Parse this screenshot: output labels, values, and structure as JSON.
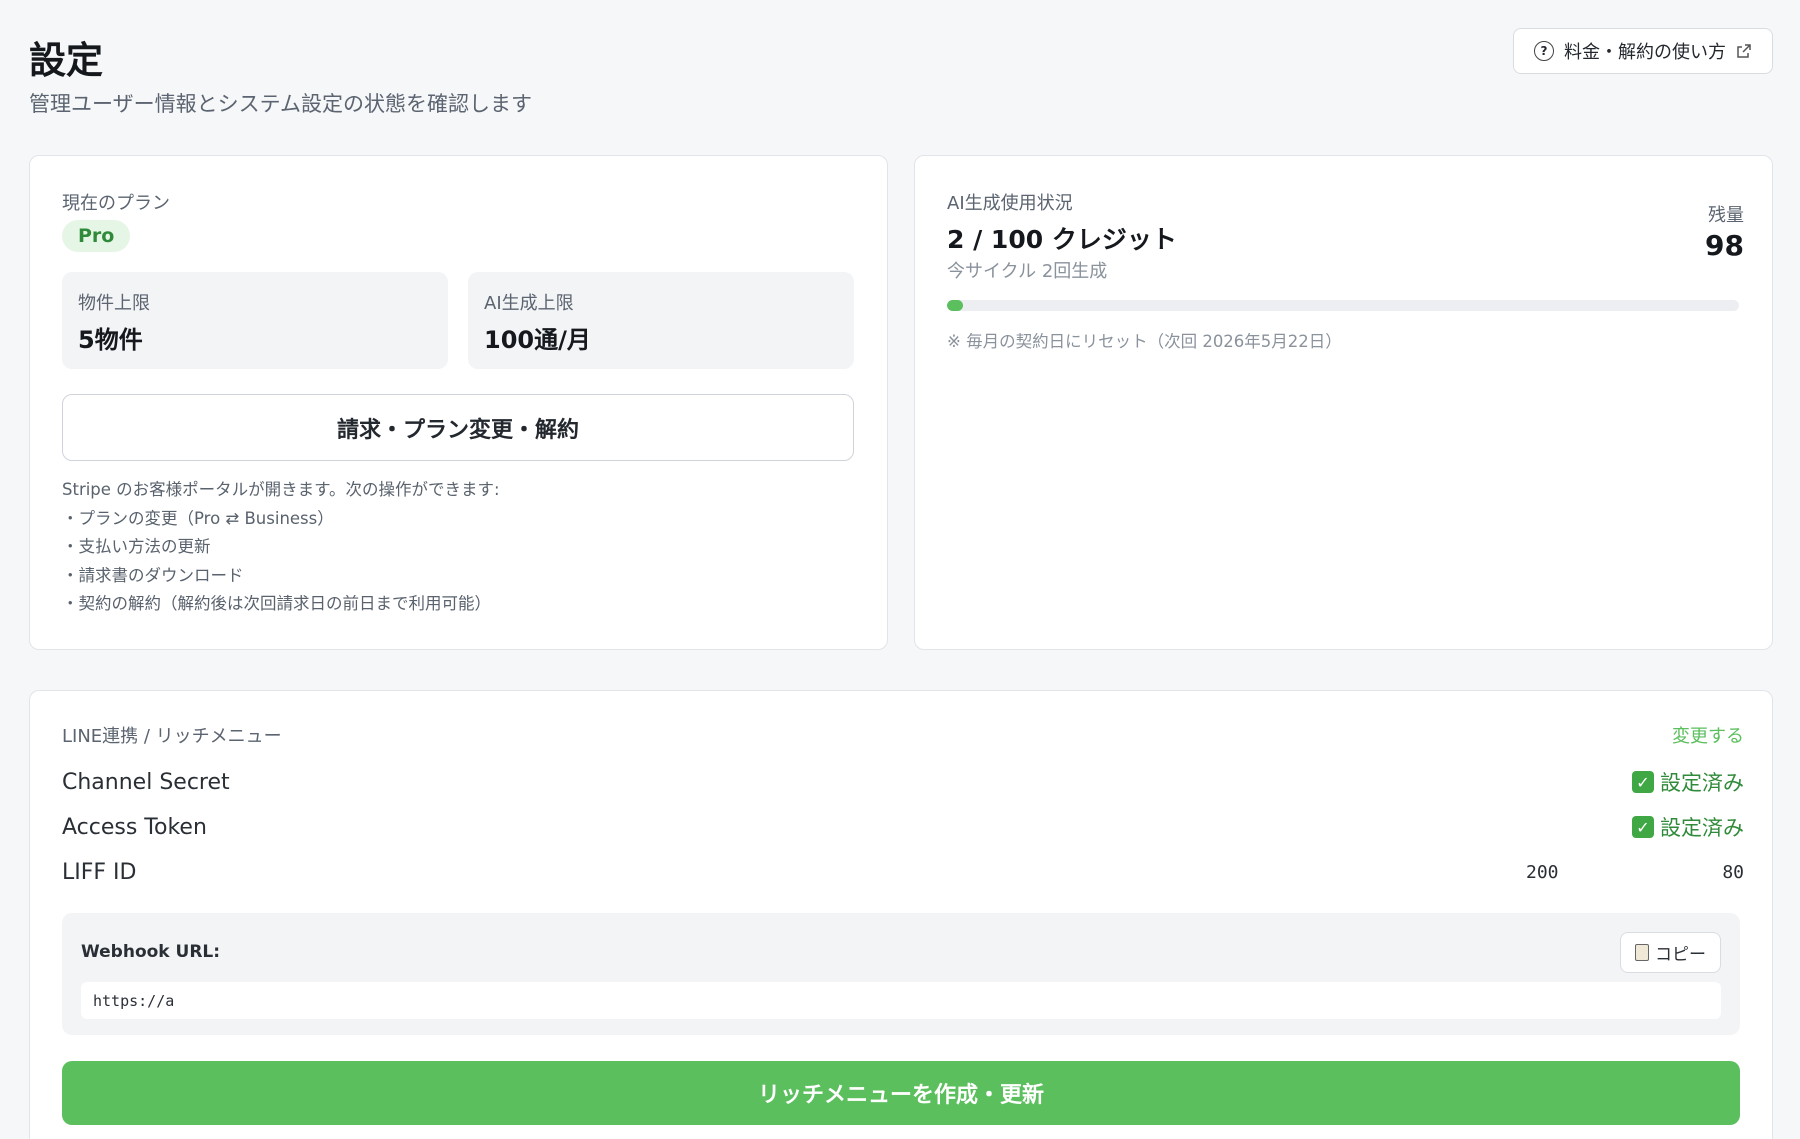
{
  "header": {
    "title": "設定",
    "subtitle": "管理ユーザー情報とシステム設定の状態を確認します",
    "help_link": "料金・解約の使い方"
  },
  "plan": {
    "label": "現在のプラン",
    "badge": "Pro",
    "stats": [
      {
        "label": "物件上限",
        "value": "5物件"
      },
      {
        "label": "AI生成上限",
        "value": "100通/月"
      }
    ],
    "billing_button": "請求・プラン変更・解約",
    "notes": [
      "Stripe のお客様ポータルが開きます。次の操作ができます:",
      "・プランの変更（Pro ⇄ Business）",
      "・支払い方法の更新",
      "・請求書のダウンロード",
      "・契約の解約（解約後は次回請求日の前日まで利用可能）"
    ]
  },
  "ai_usage": {
    "label": "AI生成使用状況",
    "credits": "2 / 100 クレジット",
    "cycle": "今サイクル 2回生成",
    "remaining_label": "残量",
    "remaining_value": "98",
    "progress_fraction": 0.02,
    "reset_note": "※ 毎月の契約日にリセット（次回 2026年5月22日）"
  },
  "line": {
    "section_label": "LINE連携 / リッチメニュー",
    "change_link": "変更する",
    "rows": [
      {
        "label": "Channel Secret",
        "status": "設定済み"
      },
      {
        "label": "Access Token",
        "status": "設定済み"
      }
    ],
    "liff": {
      "label": "LIFF ID",
      "value_start": "200",
      "value_end": "80"
    },
    "webhook": {
      "label": "Webhook URL:",
      "copy_button": "コピー",
      "url": "https://a"
    },
    "rich_menu_button": "リッチメニューを作成・更新"
  },
  "colors": {
    "accent": "#5bbf5e",
    "accent_text": "#2f8a3a",
    "badge_bg": "#e6f6e6"
  }
}
